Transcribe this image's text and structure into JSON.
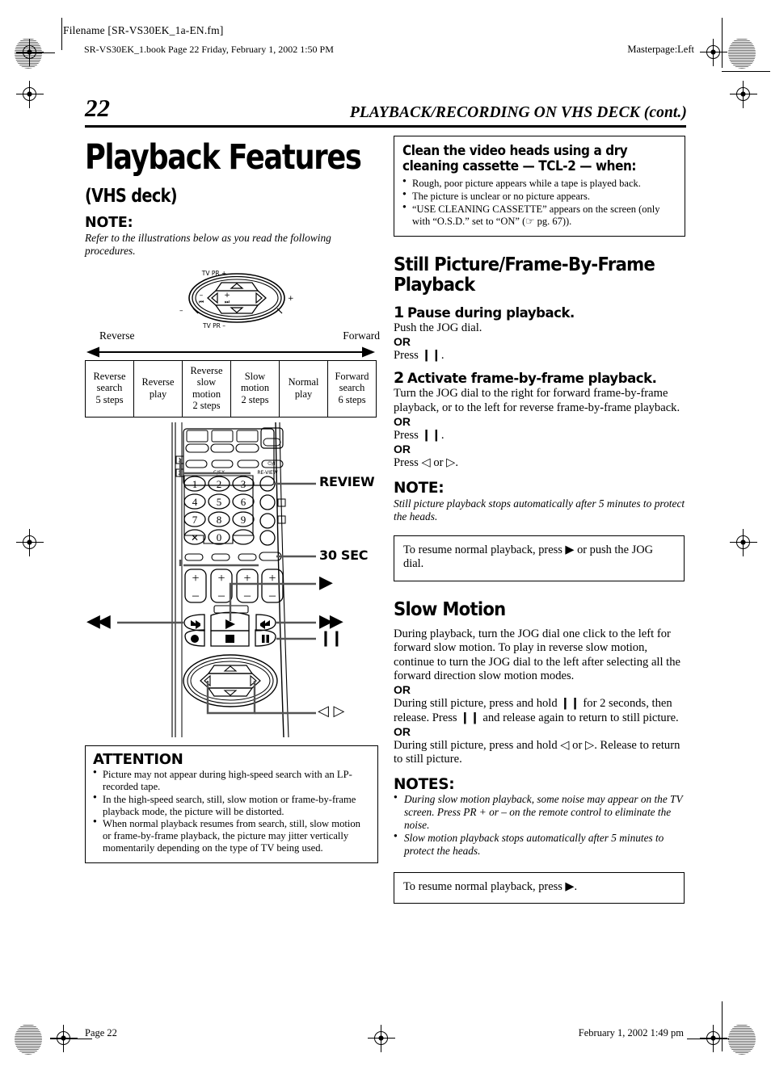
{
  "header": {
    "filename": "Filename [SR-VS30EK_1a-EN.fm]",
    "bookline": "SR-VS30EK_1.book  Page 22  Friday, February 1, 2002  1:50 PM",
    "masterpage": "Masterpage:Left"
  },
  "running_head": {
    "page_number": "22",
    "title": "PLAYBACK/RECORDING ON VHS DECK (cont.)"
  },
  "left": {
    "title": "Playback Features",
    "subtitle": "(VHS deck)",
    "note_heading": "NOTE:",
    "note_body": "Refer to the illustrations below as you read the following procedures.",
    "jog_dial": {
      "top_label": "TV PR +",
      "bottom_label": "TV PR –",
      "left_minus": "–",
      "right_plus": "+",
      "left_skip": "⏮",
      "right_skip": "⏭",
      "outer_right": "+",
      "outer_left": "–"
    },
    "direction": {
      "reverse": "Reverse",
      "forward": "Forward"
    },
    "modes_table": {
      "cells": [
        "Reverse\nsearch\n5 steps",
        "Reverse\nplay",
        "Reverse\nslow\nmotion\n2 steps",
        "Slow\nmotion\n2 steps",
        "Normal\nplay",
        "Forward\nsearch\n6 steps"
      ]
    },
    "remote_callouts": {
      "review": "REVIEW",
      "thirty_sec": "30 SEC",
      "play": "▶",
      "ffwd": "▶▶",
      "rew": "◀◀",
      "pause": "❙❙",
      "arrows": "◁ ▷"
    },
    "remote_keypad": [
      "1",
      "2",
      "3",
      "4",
      "5",
      "6",
      "7",
      "8",
      "9",
      "0"
    ],
    "remote_marks": {
      "power": "⏻/I",
      "cancel": "✕",
      "c_sx": "C/SX",
      "review_label": "RE-VIEW",
      "callnum_1": "1",
      "callnum_2": "2"
    },
    "attention": {
      "title": "ATTENTION",
      "items": [
        "Picture may not appear during high-speed search with an LP-recorded tape.",
        "In the high-speed search, still, slow motion or frame-by-frame playback mode, the picture will be distorted.",
        "When normal playback resumes from search, still, slow motion or frame-by-frame playback, the picture may jitter vertically momentarily depending on the type of TV being used."
      ]
    }
  },
  "right": {
    "clean_box": {
      "title": "Clean the video heads using a dry cleaning cassette — TCL-2 — when:",
      "items": [
        "Rough, poor picture appears while a tape is played back.",
        "The picture is unclear or no picture appears.",
        "“USE CLEANING CASSETTE” appears on the screen (only with “O.S.D.” set to “ON” (☞ pg. 67))."
      ]
    },
    "still_section": {
      "heading": "Still Picture/Frame-By-Frame Playback",
      "step1": {
        "num": "1",
        "title": "Pause during playback.",
        "line1": "Push the JOG dial.",
        "or": "OR",
        "line2": "Press ❙❙."
      },
      "step2": {
        "num": "2",
        "title": "Activate frame-by-frame playback.",
        "line1": "Turn the JOG dial to the right for forward frame-by-frame playback, or to the left for reverse frame-by-frame playback.",
        "or1": "OR",
        "line2": "Press ❙❙.",
        "or2": "OR",
        "line3": "Press ◁ or ▷."
      },
      "note_heading": "NOTE:",
      "note_body": "Still picture playback stops automatically after 5 minutes to protect the heads.",
      "resume_box": "To resume normal playback, press ▶ or push the JOG dial."
    },
    "slow_section": {
      "heading": "Slow Motion",
      "para1": "During playback, turn the JOG dial one click to the left for forward slow motion. To play in reverse slow motion, continue to turn the JOG dial to the left after selecting all the forward direction slow motion modes.",
      "or1": "OR",
      "para2": "During still picture, press and hold ❙❙ for 2 seconds, then release. Press ❙❙ and release again to return to still picture.",
      "or2": "OR",
      "para3": "During still picture, press and hold ◁ or ▷. Release to return to still picture.",
      "notes_heading": "NOTES:",
      "notes": [
        "During slow motion playback, some noise may appear on the TV screen. Press PR + or – on the remote control to eliminate the noise.",
        "Slow motion playback stops automatically after 5 minutes to protect the heads."
      ],
      "resume_box": "To resume normal playback, press ▶."
    }
  },
  "footer": {
    "left": "Page 22",
    "right": "February 1, 2002 1:49 pm"
  }
}
